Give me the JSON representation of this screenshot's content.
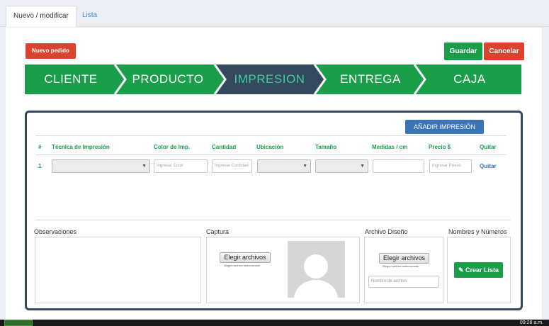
{
  "tabs": {
    "active": "Nuevo / modificar",
    "other": "Lista"
  },
  "actions": {
    "new_order": "Nuevo pedido",
    "save": "Guardar",
    "cancel": "Cancelar"
  },
  "steps": [
    {
      "label": "CLIENTE",
      "state": "done"
    },
    {
      "label": "PRODUCTO",
      "state": "done"
    },
    {
      "label": "IMPRESION",
      "state": "active"
    },
    {
      "label": "ENTREGA",
      "state": "done"
    },
    {
      "label": "CAJA",
      "state": "done"
    }
  ],
  "colors": {
    "green": "#1a9e4a",
    "red": "#d9432f",
    "navy": "#34495e",
    "blue": "#3b74b5",
    "active_text": "#3ed09b"
  },
  "impresion": {
    "add_button": "AÑADIR IMPRESIÓN",
    "headers": [
      "#",
      "Técnica de Impresión",
      "Color de Imp.",
      "Cantidad",
      "Ubicación",
      "Tamaño",
      "Medidas / cm",
      "Precio $",
      "Quitar"
    ],
    "row": {
      "num": "1",
      "color_placeholder": "Ingresar Color",
      "cantidad_placeholder": "Ingresar Cantidad",
      "precio_placeholder": "Ingresar Precio",
      "remove": "Quitar"
    }
  },
  "sections": {
    "observaciones": "Observaciones",
    "captura": "Captura",
    "archivo": "Archivo Diseño",
    "nombres": "Nombres y Números"
  },
  "files": {
    "choose": "Elegir archivos",
    "none_selected": "Ningún archivo seleccionado",
    "file_name_placeholder": "Nombre de archivo"
  },
  "list_button": "Crear Lista",
  "taskbar": {
    "clock": "09:28 a.m."
  }
}
